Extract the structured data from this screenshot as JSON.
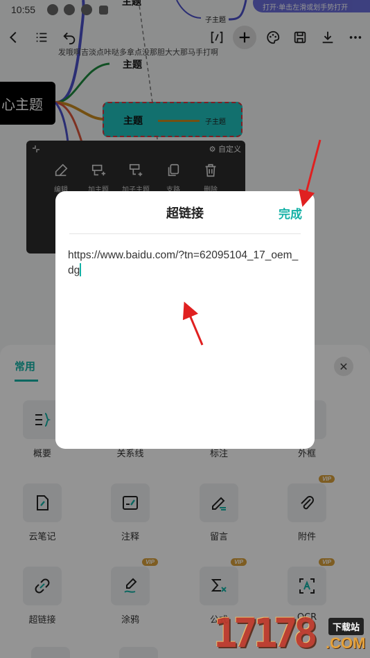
{
  "status_bar": {
    "time": "10:55",
    "notification": "打开·单击左滑或划手势打开"
  },
  "toolbar": {
    "back_icon": "arrow-left-icon",
    "outline_icon": "outline-list-icon",
    "undo_icon": "undo-icon",
    "bracket_icon": "bracket-icon",
    "add_icon": "plus-icon",
    "theme_icon": "palette-icon",
    "save_icon": "save-icon",
    "download_icon": "download-icon",
    "more_icon": "more-icon"
  },
  "mindmap": {
    "hint_text": "发哦啊吉淡点咔哒多拿点没那胆大大那马手打啊",
    "center_topic": "心主题",
    "top_topic": "主题",
    "top_subtopic": "子主题",
    "topic_1": "主题",
    "selected_topic": "主题",
    "selected_subtopic": "子主题"
  },
  "context_menu": {
    "custom_label": "自定义",
    "items": [
      {
        "label": "编辑",
        "icon": "edit-icon"
      },
      {
        "label": "加主题",
        "icon": "add-topic-icon"
      },
      {
        "label": "加子主题",
        "icon": "add-subtopic-icon"
      },
      {
        "label": "支路",
        "icon": "copy-icon"
      },
      {
        "label": "删除",
        "icon": "trash-icon"
      }
    ]
  },
  "bottom_sheet": {
    "tab_label": "常用",
    "close_icon": "close-icon",
    "tools": [
      {
        "label": "概要",
        "icon": "summary-brace-icon",
        "vip": ""
      },
      {
        "label": "关系线",
        "icon": "relation-line-icon",
        "vip": ""
      },
      {
        "label": "标注",
        "icon": "callout-icon",
        "vip": ""
      },
      {
        "label": "外框",
        "icon": "frame-icon",
        "vip": ""
      },
      {
        "label": "云笔记",
        "icon": "cloud-note-icon",
        "vip": ""
      },
      {
        "label": "注释",
        "icon": "comment-note-icon",
        "vip": ""
      },
      {
        "label": "留言",
        "icon": "message-pen-icon",
        "vip": ""
      },
      {
        "label": "附件",
        "icon": "paperclip-icon",
        "vip": "VIP"
      },
      {
        "label": "超链接",
        "icon": "link-icon",
        "vip": ""
      },
      {
        "label": "涂鸦",
        "icon": "doodle-icon",
        "vip": "VIP"
      },
      {
        "label": "公式",
        "icon": "formula-icon",
        "vip": "VIP"
      },
      {
        "label": "OCR",
        "icon": "ocr-icon",
        "vip": "VIP"
      }
    ]
  },
  "dialog": {
    "title": "超链接",
    "done_label": "完成",
    "url_value": "https://www.baidu.com/?tn=62095104_17_oem_dg"
  },
  "watermark": {
    "number": "17178",
    "badge": "下载站",
    "suffix": ".COM"
  },
  "colors": {
    "accent": "#14b1a6",
    "selected_node": "#20c2be",
    "selected_border": "#d9363e",
    "annotation_arrow": "#e02020"
  }
}
